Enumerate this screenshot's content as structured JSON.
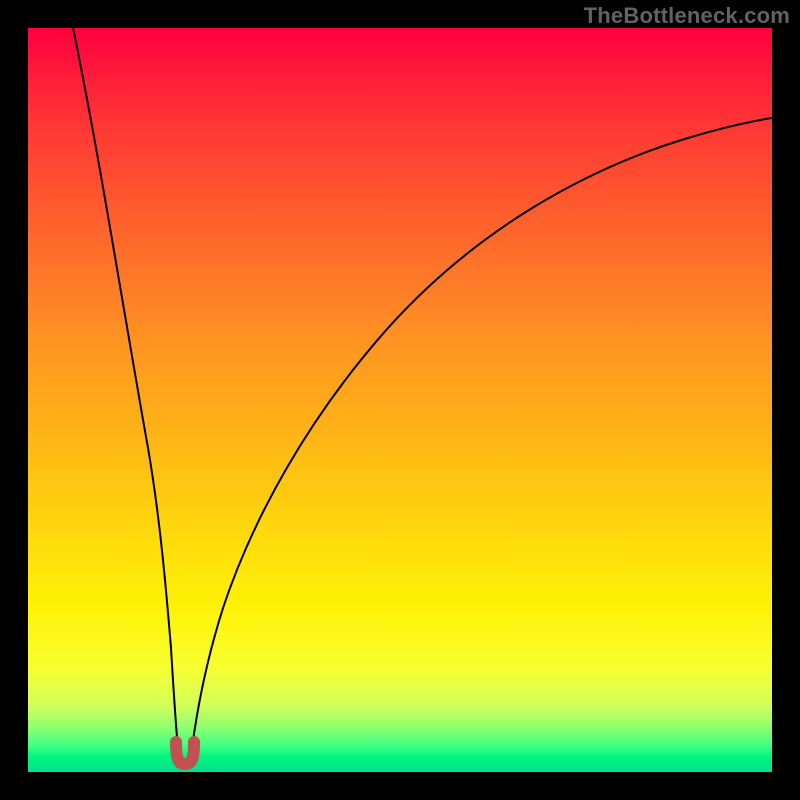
{
  "attribution": "TheBottleneck.com",
  "chart_data": {
    "type": "line",
    "title": "",
    "xlabel": "",
    "ylabel": "",
    "x_range": [
      0,
      100
    ],
    "y_range": [
      0,
      100
    ],
    "grid": false,
    "legend": false,
    "annotations": [],
    "background_gradient": {
      "direction": "vertical",
      "stops": [
        {
          "pos": 0.0,
          "color": "#ff003f",
          "meaning": "severe bottleneck"
        },
        {
          "pos": 0.5,
          "color": "#ffb516",
          "meaning": "moderate"
        },
        {
          "pos": 0.85,
          "color": "#fff207",
          "meaning": "mild"
        },
        {
          "pos": 1.0,
          "color": "#00df90",
          "meaning": "balanced"
        }
      ]
    },
    "series": [
      {
        "name": "left-branch",
        "x": [
          6,
          8,
          10,
          12,
          14,
          16,
          18,
          19.4,
          19.6,
          19.8
        ],
        "y": [
          100,
          85,
          70,
          55,
          41,
          28,
          15,
          5,
          3,
          2
        ]
      },
      {
        "name": "right-branch",
        "x": [
          22.2,
          22.5,
          23,
          25,
          28,
          33,
          40,
          50,
          62,
          76,
          90,
          100
        ],
        "y": [
          2,
          3,
          5,
          12,
          22,
          34,
          46,
          58,
          68,
          76,
          82,
          86
        ]
      }
    ],
    "marker": {
      "name": "optimal-point",
      "shape": "u",
      "color": "#c25151",
      "x_center": 21,
      "y_center": 2,
      "width": 3.5,
      "height": 3
    }
  }
}
